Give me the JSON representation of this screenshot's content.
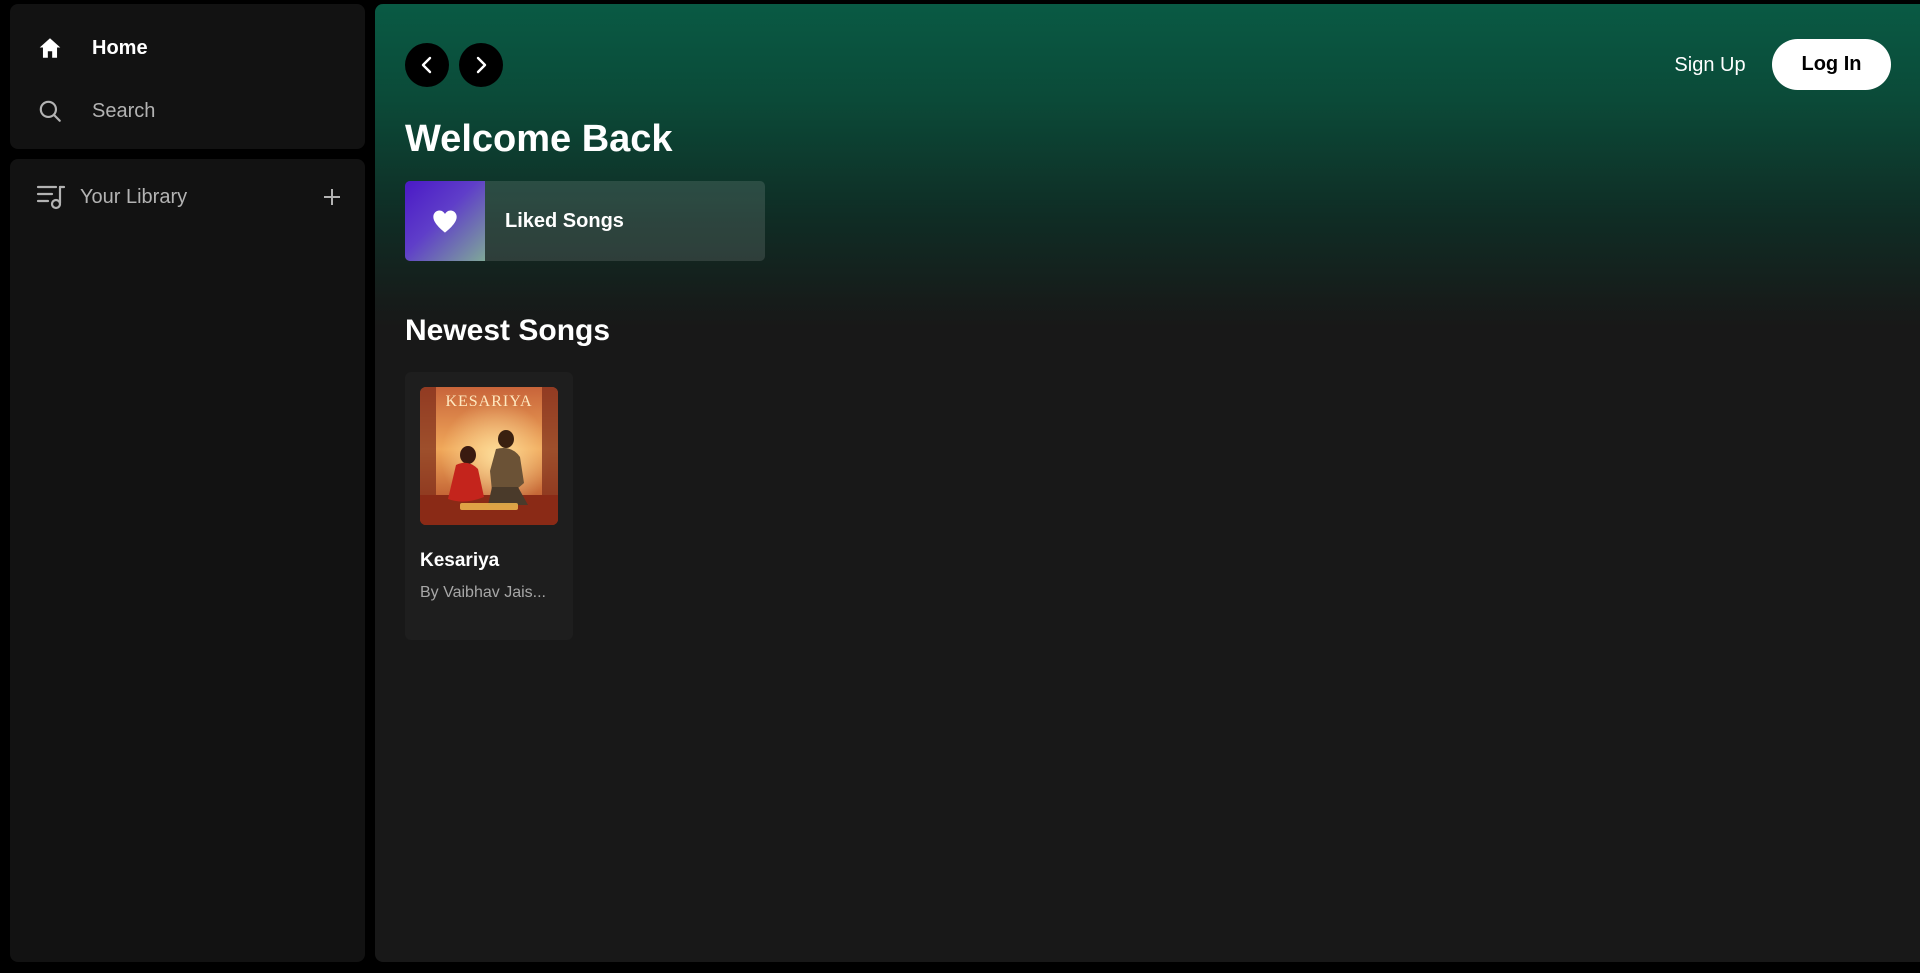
{
  "sidebar": {
    "nav": [
      {
        "label": "Home",
        "icon": "home-icon"
      },
      {
        "label": "Search",
        "icon": "search-icon"
      }
    ],
    "library": {
      "label": "Your Library",
      "icon": "library-icon",
      "add_icon": "plus-icon"
    }
  },
  "header": {
    "back_icon": "chevron-left-icon",
    "forward_icon": "chevron-right-icon",
    "signup_label": "Sign Up",
    "login_label": "Log In"
  },
  "main": {
    "title": "Welcome Back",
    "liked": {
      "label": "Liked Songs",
      "icon": "heart-icon"
    },
    "section_title": "Newest Songs",
    "songs": [
      {
        "title": "Kesariya",
        "artist": "By Vaibhav Jais...",
        "cover_text": "KESARIYA"
      }
    ]
  },
  "colors": {
    "app_background": "#000000",
    "panel_background": "#121212",
    "main_background": "#181818",
    "header_gradient_top": "#095a44",
    "muted_text": "#b3b3b3",
    "button_light": "#ffffff"
  }
}
